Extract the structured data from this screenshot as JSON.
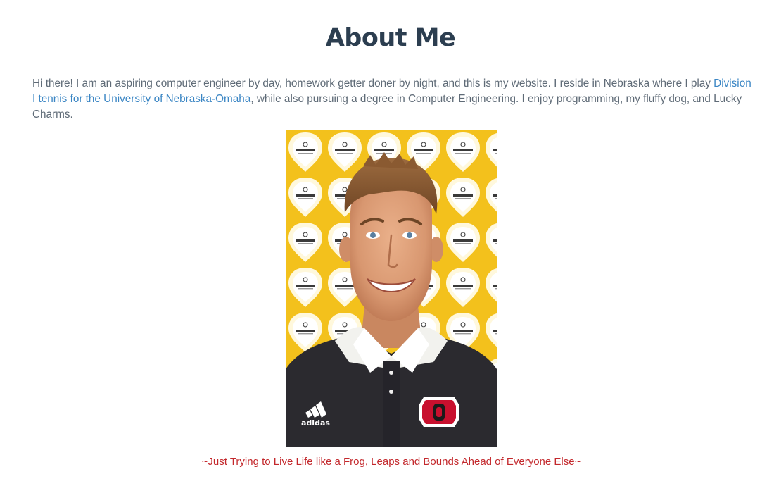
{
  "page": {
    "title": "About Me"
  },
  "intro": {
    "text_before": "Hi there! I am an aspiring computer engineer by day, homework getter doner by night, and this is my website. I reside in Nebraska where I play ",
    "link_text": "Division I tennis for the University of Nebraska-Omaha",
    "text_after": ", while also pursuing a degree in Computer Engineering. I enjoy programming, my fluffy dog, and Lucky Charms."
  },
  "photo": {
    "alt": "Portrait photo",
    "backdrop_logo_text": "Children's",
    "shirt_brand": "adidas",
    "crest_letter": "O"
  },
  "caption": {
    "text": "~Just Trying to Live Life like a Frog, Leaps and Bounds Ahead of Everyone Else~"
  },
  "colors": {
    "title": "#2c3e50",
    "body_text": "#5f6b77",
    "link": "#3b86c4",
    "caption": "#c3282c",
    "backdrop_yellow": "#f4c21a"
  }
}
